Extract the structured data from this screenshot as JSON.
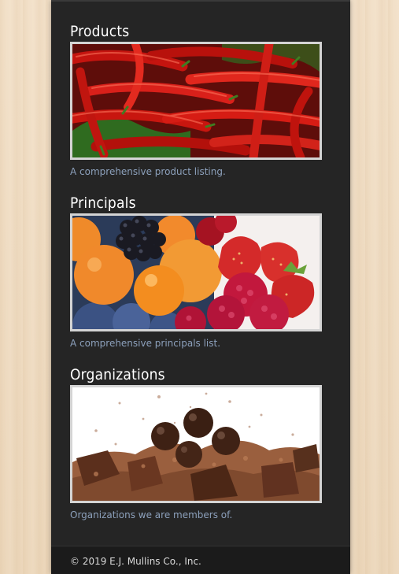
{
  "sections": [
    {
      "title": "Products",
      "caption": "A comprehensive product listing."
    },
    {
      "title": "Principals",
      "caption": "A comprehensive principals list."
    },
    {
      "title": "Organizations",
      "caption": "Organizations we are members of."
    }
  ],
  "footer": {
    "copyright": "© 2019 E.J. Mullins Co., Inc."
  },
  "colors": {
    "page_background": "#efdcc2",
    "panel": "#252525",
    "caption_link": "#8ca0bb",
    "footer_bar": "#1b1b1b"
  },
  "images": [
    "red-chili-peppers-photo",
    "mixed-fruit-berries-photo",
    "chocolate-cocoa-powder-photo"
  ]
}
